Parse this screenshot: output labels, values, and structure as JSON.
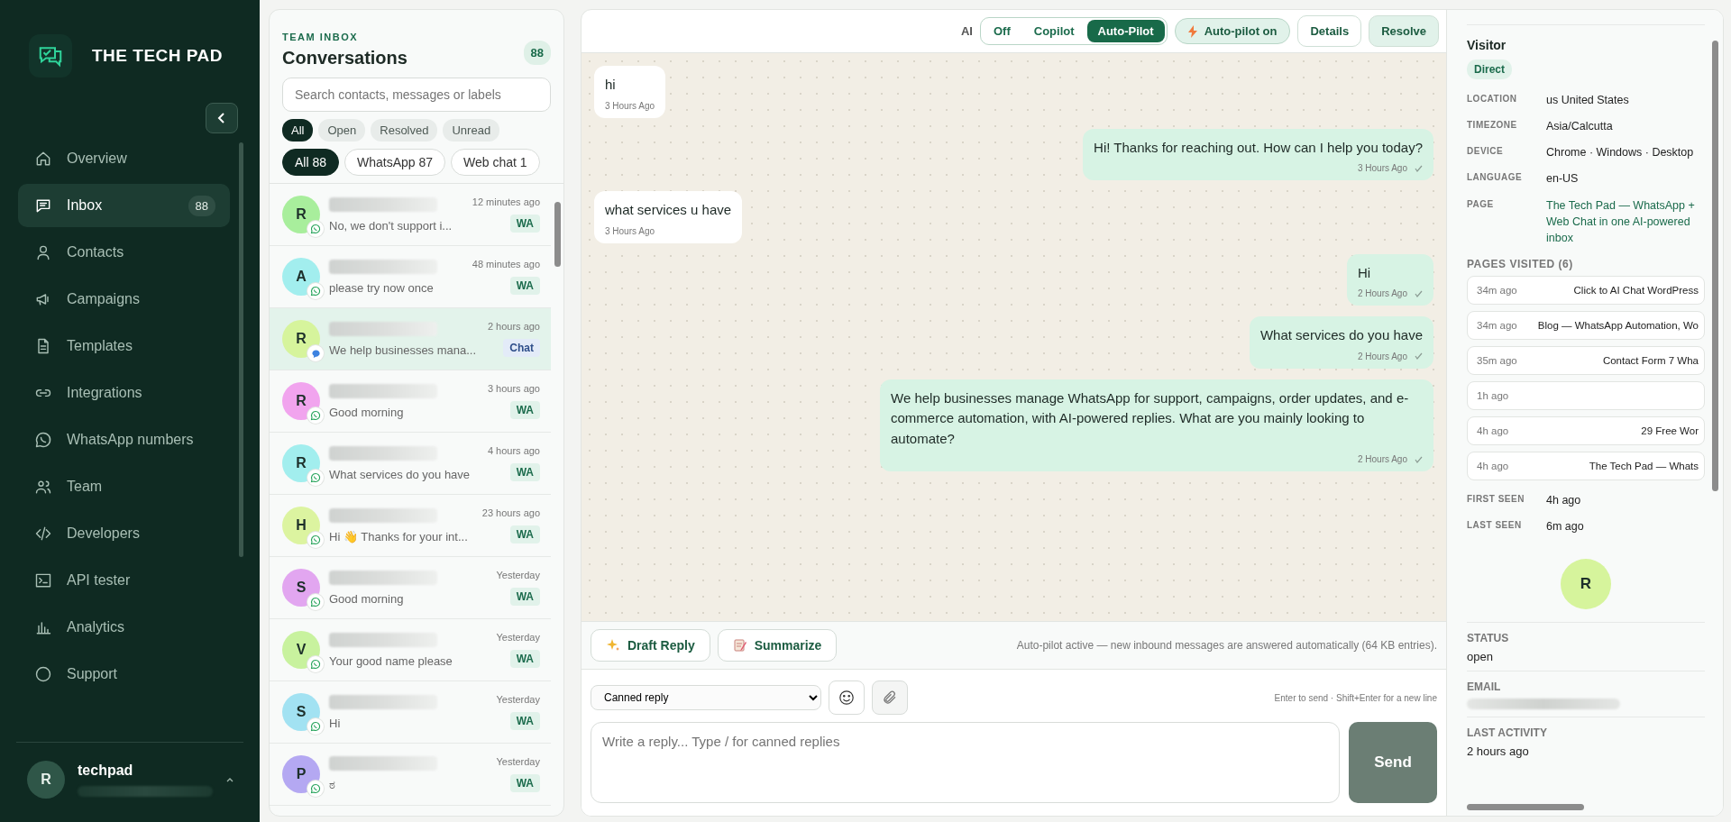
{
  "sidebar": {
    "brand": "THE TECH PAD",
    "nav": [
      {
        "label": "Overview",
        "selected": false
      },
      {
        "label": "Inbox",
        "selected": true,
        "badge": "88"
      },
      {
        "label": "Contacts",
        "selected": false
      },
      {
        "label": "Campaigns",
        "selected": false
      },
      {
        "label": "Templates",
        "selected": false
      },
      {
        "label": "Integrations",
        "selected": false
      },
      {
        "label": "WhatsApp numbers",
        "selected": false
      },
      {
        "label": "Team",
        "selected": false
      },
      {
        "label": "Developers",
        "selected": false
      },
      {
        "label": "API tester",
        "selected": false
      },
      {
        "label": "Analytics",
        "selected": false
      },
      {
        "label": "Support",
        "selected": false
      }
    ],
    "user": {
      "avatar": "R",
      "name": "techpad"
    }
  },
  "conversations": {
    "eyebrow": "TEAM INBOX",
    "title": "Conversations",
    "count": "88",
    "search": {
      "placeholder": "Search contacts, messages or labels"
    },
    "status_filters": [
      {
        "label": "All",
        "selected": true
      },
      {
        "label": "Open",
        "selected": false
      },
      {
        "label": "Resolved",
        "selected": false
      },
      {
        "label": "Unread",
        "selected": false
      }
    ],
    "channel_filters": [
      {
        "label": "All 88",
        "selected": true
      },
      {
        "label": "WhatsApp 87",
        "selected": false
      },
      {
        "label": "Web chat 1",
        "selected": false
      }
    ],
    "items": [
      {
        "avatar": "R",
        "color": "#a8ee9c",
        "time": "12 minutes ago",
        "preview": "No, we don't support i...",
        "kind": "whatsapp",
        "tag": "WA",
        "selected": false
      },
      {
        "avatar": "A",
        "color": "#a2eeee",
        "time": "48 minutes ago",
        "preview": "please try now once",
        "kind": "whatsapp",
        "tag": "WA",
        "selected": false
      },
      {
        "avatar": "R",
        "color": "#d6f49c",
        "time": "2 hours ago",
        "preview": "We help businesses mana...",
        "kind": "webchat",
        "tag": "Chat",
        "selected": true
      },
      {
        "avatar": "R",
        "color": "#f1a4ee",
        "time": "3 hours ago",
        "preview": "Good morning",
        "kind": "whatsapp",
        "tag": "WA",
        "selected": false
      },
      {
        "avatar": "R",
        "color": "#a2eeee",
        "time": "4 hours ago",
        "preview": "What services do you have",
        "kind": "whatsapp",
        "tag": "WA",
        "selected": false
      },
      {
        "avatar": "H",
        "color": "#dcf4a0",
        "time": "23 hours ago",
        "preview": "Hi 👋 Thanks for your int...",
        "kind": "whatsapp",
        "tag": "WA",
        "selected": false
      },
      {
        "avatar": "S",
        "color": "#e2a6f0",
        "time": "Yesterday",
        "preview": "Good morning",
        "kind": "whatsapp",
        "tag": "WA",
        "selected": false
      },
      {
        "avatar": "V",
        "color": "#c8f29e",
        "time": "Yesterday",
        "preview": "Your good name please",
        "kind": "whatsapp",
        "tag": "WA",
        "selected": false
      },
      {
        "avatar": "S",
        "color": "#a2e2f2",
        "time": "Yesterday",
        "preview": "Hi",
        "kind": "whatsapp",
        "tag": "WA",
        "selected": false
      },
      {
        "avatar": "P",
        "color": "#b4a8f2",
        "time": "Yesterday",
        "preview": "ಠ",
        "kind": "whatsapp",
        "tag": "WA",
        "selected": false
      }
    ]
  },
  "chat": {
    "ai_label": "AI",
    "ai_modes": [
      {
        "label": "Off",
        "selected": false
      },
      {
        "label": "Copilot",
        "selected": false
      },
      {
        "label": "Auto-Pilot",
        "selected": true
      }
    ],
    "autopilot_badge": "Auto-pilot on",
    "details_button": "Details",
    "resolve_button": "Resolve",
    "messages": [
      {
        "kind": "in",
        "text": "hi",
        "time": "3 Hours Ago"
      },
      {
        "kind": "out",
        "text": "Hi! Thanks for reaching out. How can I help you today?",
        "time": "3 Hours Ago"
      },
      {
        "kind": "in",
        "text": "what services u have",
        "time": "3 Hours Ago"
      },
      {
        "kind": "out",
        "text": "Hi",
        "time": "2 Hours Ago"
      },
      {
        "kind": "out",
        "text": "What services do you have",
        "time": "2 Hours Ago"
      },
      {
        "kind": "out",
        "text": "We help businesses manage WhatsApp for support, campaigns, order updates, and e-commerce automation, with AI-powered replies. What are you mainly looking to automate?",
        "time": "2 Hours Ago"
      }
    ],
    "draft_button": "Draft Reply",
    "summarize_button": "Summarize",
    "autopilot_note": "Auto-pilot active — new inbound messages are answered automatically (64 KB entries).",
    "canned_select": "Canned reply",
    "hint": "Enter to send · Shift+Enter for a new line",
    "reply": {
      "placeholder": "Write a reply... Type / for canned replies"
    },
    "send_button": "Send"
  },
  "visitor": {
    "title": "Visitor",
    "source": "Direct",
    "fields": [
      {
        "label": "LOCATION",
        "value": "us United States",
        "kind": "text"
      },
      {
        "label": "TIMEZONE",
        "value": "Asia/Calcutta",
        "kind": "text"
      },
      {
        "label": "DEVICE",
        "value": "Chrome · Windows · Desktop",
        "kind": "text"
      },
      {
        "label": "LANGUAGE",
        "value": "en-US",
        "kind": "text"
      },
      {
        "label": "PAGE",
        "value": "The Tech Pad — WhatsApp + Web Chat in one AI-powered inbox",
        "kind": "link"
      }
    ],
    "pages_title": "PAGES VISITED (6)",
    "pages": [
      {
        "time": "34m ago",
        "title": "Click to AI Chat WordPress"
      },
      {
        "time": "34m ago",
        "title": "Blog — WhatsApp Automation, Wo"
      },
      {
        "time": "35m ago",
        "title": "Contact Form 7 Wha"
      },
      {
        "time": "1h ago"
      },
      {
        "time": "4h ago",
        "title": "29 Free Wor"
      },
      {
        "time": "4h ago",
        "title": "The Tech Pad — Whats"
      }
    ],
    "seen": [
      {
        "label": "FIRST SEEN",
        "value": "4h ago"
      },
      {
        "label": "LAST SEEN",
        "value": "6m ago"
      }
    ],
    "avatar": "R",
    "status_label": "STATUS",
    "status": "open",
    "email_label": "EMAIL",
    "activity_label": "LAST ACTIVITY",
    "activity": "2 hours ago"
  }
}
